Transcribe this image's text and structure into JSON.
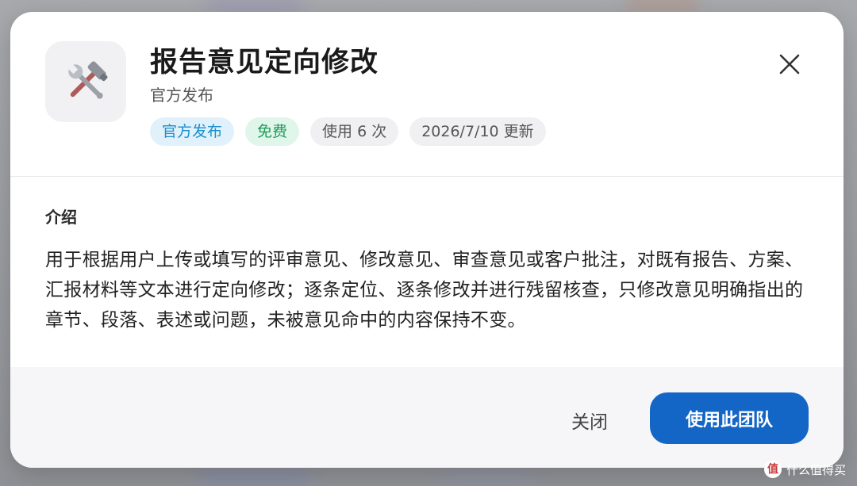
{
  "dialog": {
    "title": "报告意见定向修改",
    "publisher": "官方发布",
    "tags": {
      "official": "官方发布",
      "free": "免费",
      "usage": "使用 6 次",
      "updated": "2026/7/10 更新"
    },
    "intro": {
      "heading": "介绍",
      "text": "用于根据用户上传或填写的评审意见、修改意见、审查意见或客户批注，对既有报告、方案、汇报材料等文本进行定向修改；逐条定位、逐条修改并进行残留核查，只修改意见明确指出的章节、段落、表述或问题，未被意见命中的内容保持不变。"
    },
    "footer": {
      "close_label": "关闭",
      "use_label": "使用此团队"
    }
  },
  "icons": {
    "app": "hammer-wrench-icon",
    "close": "close-icon"
  },
  "colors": {
    "primary": "#1466c6",
    "tag_blue": "#1a8fcc",
    "tag_green": "#1d9b5a"
  },
  "watermark": {
    "text": "什么值得买",
    "logo": "值"
  }
}
